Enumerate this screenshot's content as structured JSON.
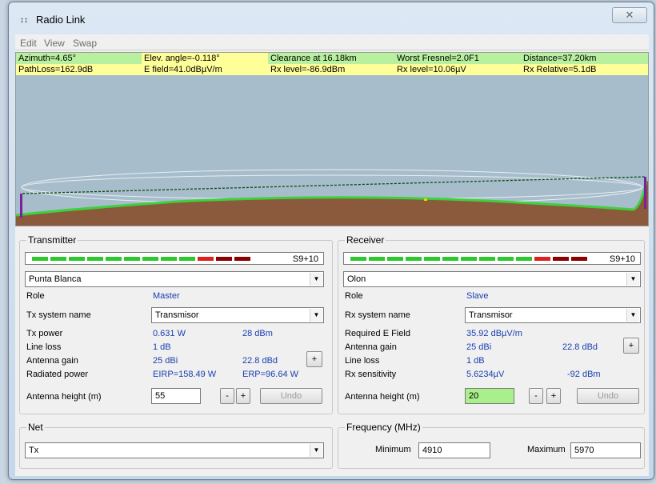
{
  "window": {
    "title": "Radio Link",
    "icon": "radio-link-app-icon"
  },
  "menu": [
    "Edit",
    "View",
    "Swap"
  ],
  "info": {
    "row1": [
      "Azimuth=4.65°",
      "Elev. angle=-0.118°",
      "Clearance at 16.18km",
      "Worst Fresnel=2.0F1",
      "Distance=37.20km"
    ],
    "row2": [
      "PathLoss=162.9dB",
      "E field=41.0dBµV/m",
      "Rx level=-86.9dBm",
      "Rx level=10.06µV",
      "Rx Relative=5.1dB"
    ]
  },
  "colors": {
    "plot_sky": "#a7bdcc",
    "terrain": "#8b5a3c",
    "terrain_edge": "#3ed13e",
    "info_bg": "#ffff99",
    "info_bg_alt": "#b8f0a0"
  },
  "transmitter": {
    "group_title": "Transmitter",
    "signal": "S9+10",
    "site": "Punta Blanca",
    "role_label": "Role",
    "role": "Master",
    "system_label": "Tx system name",
    "system": "Transmisor",
    "power_label": "Tx power",
    "power_w": "0.631 W",
    "power_dbm": "28 dBm",
    "line_loss_label": "Line loss",
    "line_loss": "1 dB",
    "gain_label": "Antenna gain",
    "gain_dbi": "25 dBi",
    "gain_dbd": "22.8 dBd",
    "radiated_label": "Radiated power",
    "eirp": "EIRP=158.49 W",
    "erp": "ERP=96.64 W",
    "height_label": "Antenna height (m)",
    "height": "55",
    "undo": "Undo"
  },
  "receiver": {
    "group_title": "Receiver",
    "signal": "S9+10",
    "site": "Olon",
    "role_label": "Role",
    "role": "Slave",
    "system_label": "Rx system name",
    "system": "Transmisor",
    "field_label": "Required E Field",
    "field": "35.92 dBµV/m",
    "gain_label": "Antenna gain",
    "gain_dbi": "25 dBi",
    "gain_dbd": "22.8 dBd",
    "line_loss_label": "Line loss",
    "line_loss": "1 dB",
    "sens_label": "Rx sensitivity",
    "sens_uv": "5.6234µV",
    "sens_dbm": "-92 dBm",
    "height_label": "Antenna height (m)",
    "height": "20",
    "undo": "Undo"
  },
  "net": {
    "group_title": "Net",
    "value": "Tx"
  },
  "frequency": {
    "group_title": "Frequency (MHz)",
    "min_label": "Minimum",
    "min": "4910",
    "max_label": "Maximum",
    "max": "5970"
  },
  "buttons": {
    "plus": "+",
    "minus": "-"
  }
}
